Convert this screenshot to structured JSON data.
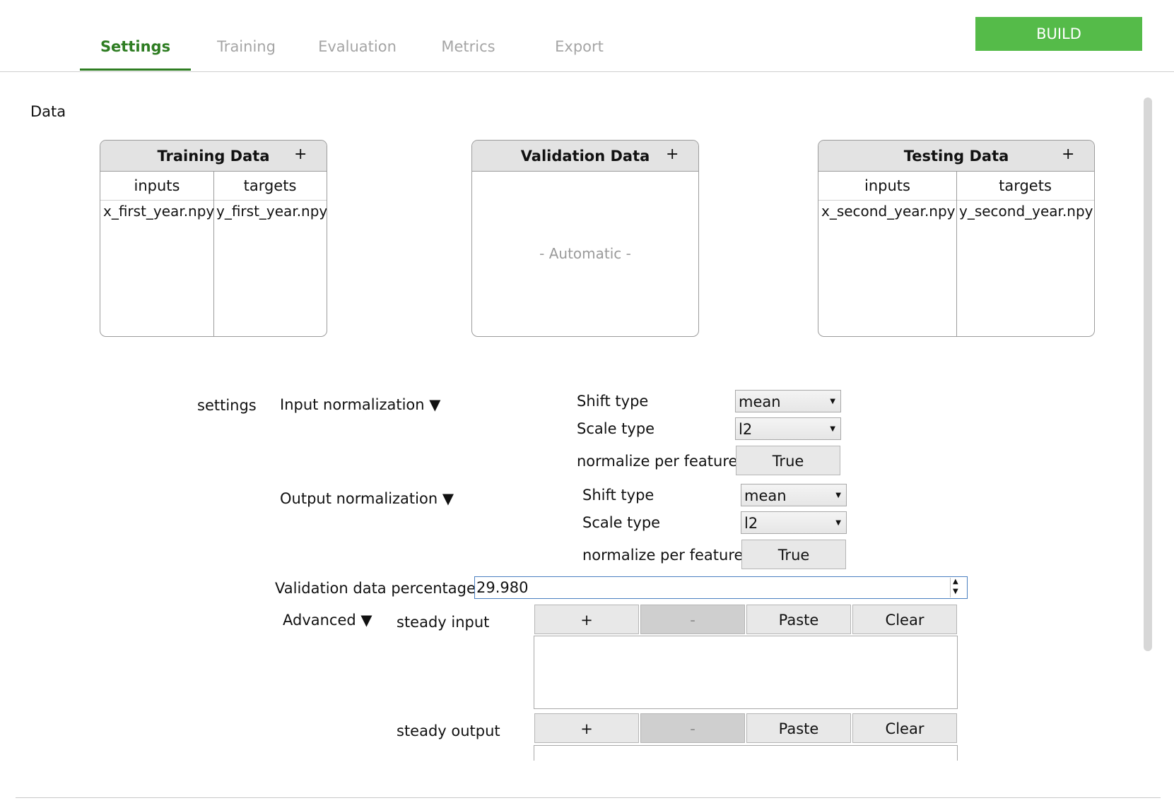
{
  "tabs": {
    "settings": "Settings",
    "training": "Training",
    "evaluation": "Evaluation",
    "metrics": "Metrics",
    "export": "Export",
    "active": "Settings"
  },
  "build_label": "BUILD",
  "data_heading": "Data",
  "training_data": {
    "title": "Training Data",
    "add": "+",
    "col_inputs": "inputs",
    "col_targets": "targets",
    "input_file": "x_first_year.npy",
    "target_file": "y_first_year.npy"
  },
  "validation_data": {
    "title": "Validation Data",
    "add": "+",
    "placeholder": "- Automatic -"
  },
  "testing_data": {
    "title": "Testing Data",
    "add": "+",
    "col_inputs": "inputs",
    "col_targets": "targets",
    "input_file": "x_second_year.npy",
    "target_file": "y_second_year.npy"
  },
  "settings_label": "settings",
  "input_norm": {
    "label": "Input normalization ▼",
    "shift_label": "Shift type",
    "shift_value": "mean",
    "scale_label": "Scale type",
    "scale_value": "l2",
    "per_feature_label": "normalize per feature",
    "per_feature_value": "True"
  },
  "output_norm": {
    "label": "Output normalization ▼",
    "shift_label": "Shift type",
    "shift_value": "mean",
    "scale_label": "Scale type",
    "scale_value": "l2",
    "per_feature_label": "normalize per feature",
    "per_feature_value": "True"
  },
  "validation_pct": {
    "label": "Validation data percentage",
    "value": "29.980"
  },
  "advanced": {
    "label": "Advanced ▼",
    "steady_input_label": "steady input",
    "steady_output_label": "steady output",
    "add": "+",
    "remove": "-",
    "paste": "Paste",
    "clear": "Clear"
  },
  "colors": {
    "accent": "#2e7d22",
    "build": "#55bb49"
  }
}
